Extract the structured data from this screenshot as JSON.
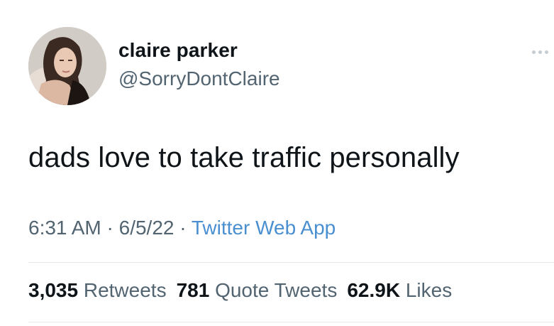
{
  "author": {
    "display_name": "claire parker",
    "handle": "@SorryDontClaire"
  },
  "tweet": {
    "text": "dads love to take traffic personally",
    "time": "6:31 AM",
    "date": "6/5/22",
    "separator": "·",
    "source": "Twitter Web App"
  },
  "stats": {
    "retweets_count": "3,035",
    "retweets_label": "Retweets",
    "quote_tweets_count": "781",
    "quote_tweets_label": "Quote Tweets",
    "likes_count": "62.9K",
    "likes_label": "Likes"
  },
  "icons": {
    "more": "more-horizontal-icon"
  },
  "colors": {
    "text_primary": "#0f1419",
    "text_secondary": "#536471",
    "link": "#4a8fd0",
    "divider": "#e6e9eb"
  }
}
